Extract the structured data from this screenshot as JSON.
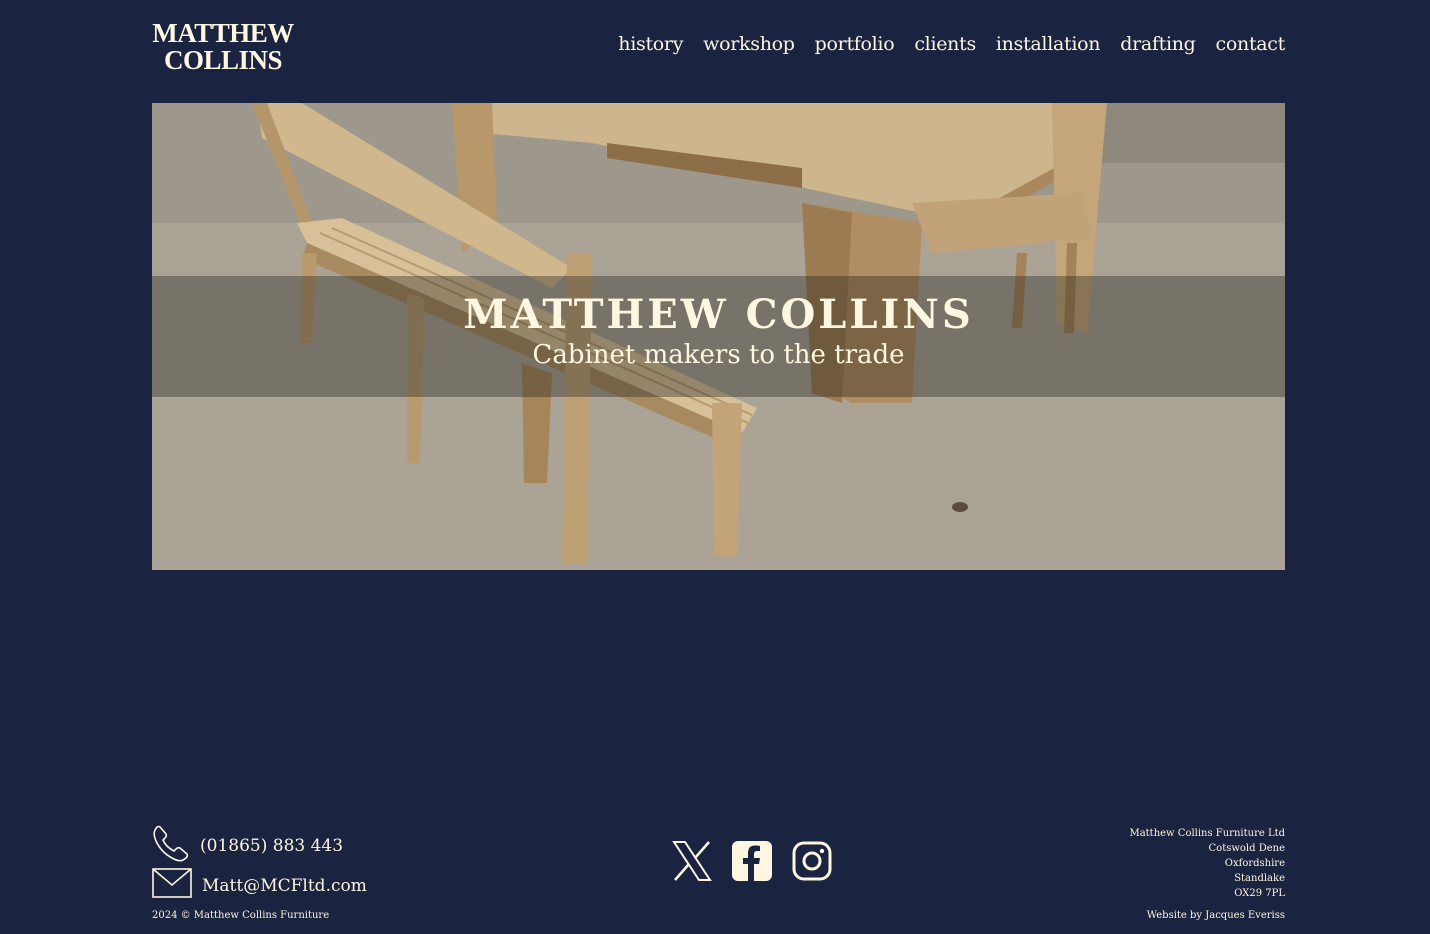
{
  "header": {
    "logo_line1": "MATTHEW",
    "logo_line2": "COLLINS",
    "nav": [
      "history",
      "workshop",
      "portfolio",
      "clients",
      "installation",
      "drafting",
      "contact"
    ]
  },
  "hero": {
    "title": "MATTHEW COLLINS",
    "subtitle": "Cabinet makers to the trade"
  },
  "footer": {
    "phone": "(01865) 883 443",
    "email": "Matt@MCFltd.com",
    "copyright": "2024 © Matthew Collins Furniture",
    "social_icons": [
      "x-icon",
      "facebook-icon",
      "instagram-icon"
    ],
    "address": [
      "Matthew Collins Furniture Ltd",
      "Cotswold Dene",
      "Oxfordshire",
      "Standlake",
      "OX29 7PL"
    ],
    "credit": "Website by Jacques Everiss"
  },
  "colors": {
    "background": "#1a2340",
    "text": "#fdf6e0"
  }
}
